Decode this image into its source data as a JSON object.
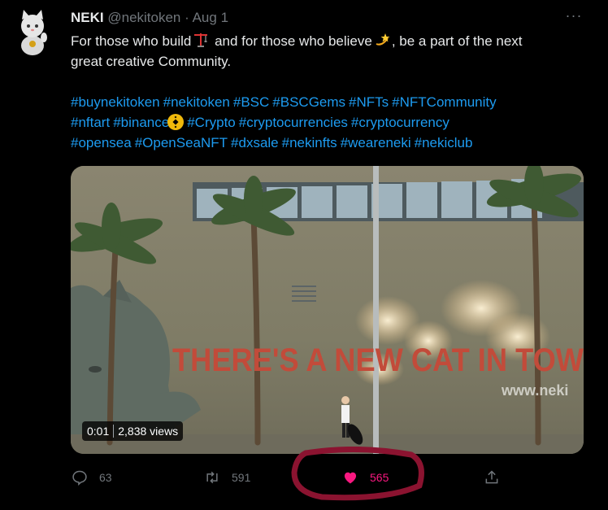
{
  "tweet": {
    "author_name": "NEKI",
    "handle": "@nekitoken",
    "separator": "·",
    "date": "Aug 1",
    "more_label": "···",
    "text_line1_part1": "For those who build",
    "text_line1_part2": " and for those who believe",
    "text_line1_part3": ", be a part of the next",
    "text_line2": "great creative Community.",
    "hashtags_line1": [
      "#buynekitoken",
      "#nekitoken",
      "#BSC",
      "#BSCGems",
      "#NFTs",
      "#NFTCommunity"
    ],
    "hashtags_line2_before": [
      "#nftart",
      "#binance"
    ],
    "hashtags_line2_after": [
      "#Crypto",
      "#cryptocurrencies",
      "#cryptocurrency"
    ],
    "hashtags_line3": [
      "#opensea",
      "#OpenSeaNFT",
      "#dxsale",
      "#nekinfts",
      "#weareneki",
      "#nekiclub"
    ]
  },
  "media": {
    "mural_text": "THERE'S A NEW CAT IN TOW",
    "url_text": "www.neki",
    "video_time": "0:01",
    "video_views": "2,838 views"
  },
  "actions": {
    "reply_count": "63",
    "retweet_count": "591",
    "like_count": "565"
  },
  "colors": {
    "background": "#000000",
    "text": "#e7e9ea",
    "muted": "#71767b",
    "link": "#1d9bf0",
    "like": "#f91880",
    "annotation": "#8b1330"
  },
  "icons": {
    "avatar": "cat-avatar-icon",
    "build": "construction-crane-icon",
    "believe": "dizzy-star-icon",
    "binance": "binance-icon",
    "reply": "reply-icon",
    "retweet": "retweet-icon",
    "like": "heart-icon",
    "share": "share-icon"
  }
}
